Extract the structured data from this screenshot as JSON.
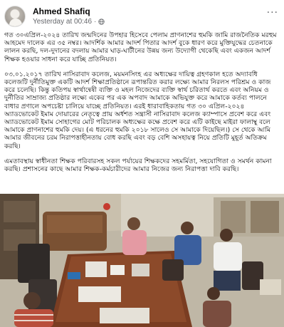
{
  "post": {
    "author": "Ahmed Shafiq",
    "timestamp": "Yesterday at 00:46",
    "separator": "·",
    "more_label": "···",
    "paragraphs": [
      "গত ৩০এপ্রিল-২০২৪ তারিখ জন্মদিনের উপহার হিসেবে পেলাম প্রাণনাশের হুমকি জামি রাজনৈতিক মরহুম আহমেদ দালেক এর ৩৫ নম্বর। আদর্শিক আমার আদর্শ পিতার আদর্শ বুকে ধারণ করে মুক্তিযুদ্ধের চেতনাকে লালন করছি, দল-দুদানের বদলায় আমার ঘাড়-ঘাটীনের উন্নয় জন্য উদ্যোগী থেকেছি এবং একজন আদর্শ শিক্ষক হওয়ার সাধনা করে যাচ্ছি প্রতিনিয়ত।",
      "০৩.০১.২০১৭ তারিখ নাসিরাবাদ কলেজ, ময়মনসিংহ এর অধ্যক্ষের দায়িত্ব গ্রহণকাল হতে অদ্যাবধি কলেজটি দুর্নীতিমুক্ত একটি আদর্শ শিক্ষাপ্রতিষ্ঠানে রূপান্তরিত করার লক্ষ্যে আমার নিরলস পরিশ্রম ও কাজ করে চলেছি। কিন্তু কতিপয় স্বার্থান্বেষী ব্যক্তি ও মহল নিজেদের ব্যক্তি স্বার্থ চরিতার্থ করতে এবং অনিয়ম ও দুর্নীতির সাম্রাজ্য প্রতিষ্ঠার লক্ষ্যে একের পর এক অপবাদ আমাকে অভিযুক্ত করে আমাকে কর্তব্য পালনে বাধার প্রণালে অপচেষ্টা চালিয়ে যাচ্ছে প্রতিনিয়ত। এরই ধারাবাহিকতায় গত ৩০ এপ্রিল-২০২৪ অ্যাডভোকেট ইমাম দোয়ারের নেতৃত্বে প্রায় অর্ধশত সন্ত্রাসী নাসিরাবাদ কলেজ ক্যাম্পাসে প্রবেশ করে এবং অ্যাডভোকেট ইমাম সোহাগের মোট পরিচালক অধ্যক্ষের কক্ষে প্রবেশ করে এটি কাইছে মাইরা ফালাম্বু বলে আমাকে প্রাণনাশের হুমকি দেয়। (এ ধরনের হুমকি ২০১৮ সালেও সে আমাকে দিয়েছিল।) সে থেকে আমি আমার জীবনের চরম নিরাপত্তাহীনতায় বোধ করছি এবং বড় বেশি অসহায়ত্ব নিয়ে প্রতিটি মুহূর্ত অতিক্রম করছি।",
      "এমতাবস্থায় স্বাধীনতা শিক্ষক পরিবারসহ সকল পর্যায়ের শিক্ষকদের সহমর্মিতা, সহযোগিতা ও সমর্থন কামনা করছি। প্রশাসনের কাছে আমার শিক্ষক-কর্মচারীদের আমার নিজের জন্য নিরাপত্তা দাবি করছি।"
    ]
  },
  "colors": {
    "text": "#050505",
    "meta": "#65676b",
    "background": "#ffffff"
  },
  "icons": {
    "globe": "globe-icon",
    "avatar": "avatar",
    "more": "more-options-icon"
  }
}
